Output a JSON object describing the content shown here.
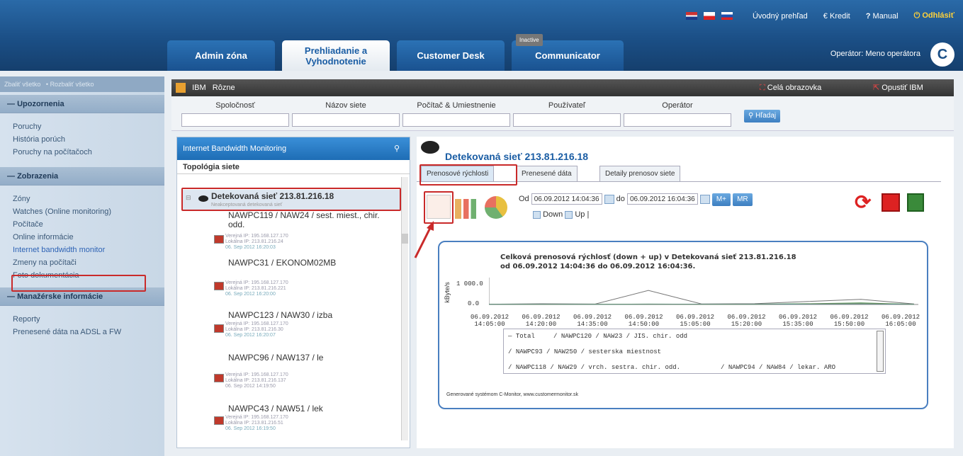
{
  "topbar": {
    "overview": "Úvodný prehľad",
    "credit": "Kredit",
    "manual": "Manual",
    "logout": "Odhlásiť"
  },
  "tabs": [
    {
      "label": "Admin zóna"
    },
    {
      "label": "Prehliadanie a Vyhodnotenie"
    },
    {
      "label": "Customer Desk"
    },
    {
      "label": "Communicator",
      "badge": "Inactive"
    }
  ],
  "operator": "Operátor: Meno operátora",
  "logo": "C",
  "sidebar": {
    "collapse_all": "Zbaliť všetko",
    "expand_all": "Rozbaliť všetko",
    "sections": [
      {
        "title": "Upozornenia",
        "items": [
          "Poruchy",
          "História porúch",
          "Poruchy na počítačoch"
        ]
      },
      {
        "title": "Zobrazenia",
        "items": [
          "Zóny",
          "Watches (Online monitoring)",
          "Počítače",
          "Online informácie",
          "Internet bandwidth monitor",
          "Zmeny na počítači",
          "Foto dokumentácia"
        ]
      },
      {
        "title": "Manažérske informácie",
        "items": [
          "Reporty",
          "Prenesené dáta na ADSL a FW"
        ]
      }
    ]
  },
  "darkbar": {
    "ibm": "IBM",
    "misc": "Rôzne",
    "fullscreen": "Celá obrazovka",
    "leave": "Opustiť IBM"
  },
  "filter": {
    "company": "Spoločnosť",
    "network": "Názov siete",
    "computer": "Počítač & Umiestnenie",
    "user": "Používateľ",
    "operator": "Operátor",
    "search": "Hľadaj"
  },
  "left_panel": {
    "title": "Internet Bandwidth Monitoring",
    "topology": "Topológia siete",
    "detected": "Detekovaná sieť 213.81.216.18",
    "detected_sub": "Neakceptovaná detekovaná sieť",
    "nodes": [
      {
        "name": "NAWPC119 / NAW24 / sest. miest., chir. odd.",
        "public": "Verejná IP: 195.168.127.170",
        "local": "Lokálna IP: 213.81.216.24",
        "date": "06. Sep 2012 16:20:03"
      },
      {
        "name": "NAWPC31 / EKONOM02MB",
        "public": "Verejná IP: 195.168.127.170",
        "local": "Lokálna IP: 213.81.216.221",
        "date": "06. Sep 2012 16:20:00"
      },
      {
        "name": "NAWPC123 / NAW30 / izba",
        "public": "Verejná IP: 195.168.127.170",
        "local": "Lokálna IP: 213.81.216.30",
        "date": "06. Sep 2012 16:20:07"
      },
      {
        "name": "NAWPC96 / NAW137 / le",
        "public": "Verejná IP: 195.168.127.170",
        "local": "Lokálna IP: 213.81.216.137",
        "date": "06. Sep 2012 14:19:50"
      },
      {
        "name": "NAWPC43 / NAW51 / lek",
        "public": "Verejná IP: 195.168.127.170",
        "local": "Lokálna IP: 213.81.216.51",
        "date": "06. Sep 2012 16:19:50"
      }
    ]
  },
  "right_panel": {
    "title": "Detekovaná sieť 213.81.216.18",
    "tabs": [
      "Prenosové rýchlosti",
      "Prenesené dáta",
      "Detaily prenosov siete"
    ],
    "from_label": "Od",
    "from_value": "06.09.2012 14:04:36",
    "to_label": "do",
    "to_value": "06.09.2012 16:04:36",
    "mplus": "M+",
    "mr": "MR",
    "down": "Down",
    "up": "Up",
    "sep": "|"
  },
  "chart_data": {
    "type": "line",
    "title": "Celková prenosová rýchlosť (down + up) v Detekovaná sieť 213.81.216.18 od 06.09.2012 14:04:36 do 06.09.2012 16:04:36.",
    "title_line1": "Celková prenosová rýchlosť (down + up) v Detekovaná sieť 213.81.216.18",
    "title_line2": "od 06.09.2012 14:04:36 do 06.09.2012 16:04:36.",
    "ylabel": "kByte/s",
    "yticks": [
      "1 000.0",
      "0.0"
    ],
    "categories": [
      "06.09.2012 14:05:00",
      "06.09.2012 14:20:00",
      "06.09.2012 14:35:00",
      "06.09.2012 14:50:00",
      "06.09.2012 15:05:00",
      "06.09.2012 15:20:00",
      "06.09.2012 15:35:00",
      "06.09.2012 15:50:00",
      "06.09.2012 16:05:00"
    ],
    "series": [
      {
        "name": "Total",
        "values": [
          10,
          25,
          15,
          520,
          20,
          30,
          110,
          190,
          20
        ]
      },
      {
        "name": "NAWPC120 / NAW23 / JIS. chir. odd",
        "values": [
          5,
          10,
          8,
          15,
          10,
          12,
          30,
          60,
          8
        ]
      },
      {
        "name": "NAWPC93 / NAW250 / sesterska miestnost",
        "values": [
          3,
          6,
          5,
          10,
          6,
          8,
          20,
          40,
          5
        ]
      },
      {
        "name": "NAWPC118 / NAW29 / vrch. sestra. chir. odd.",
        "values": [
          2,
          4,
          3,
          6,
          4,
          5,
          15,
          30,
          3
        ]
      },
      {
        "name": "NAWPC94 / NAW84 / lekar. ARO",
        "values": [
          2,
          4,
          3,
          6,
          4,
          5,
          15,
          25,
          3
        ]
      }
    ],
    "ylim": [
      0,
      1000
    ]
  },
  "footer_note": "Generované systémom C-Monitor, www.customermonitor.sk"
}
